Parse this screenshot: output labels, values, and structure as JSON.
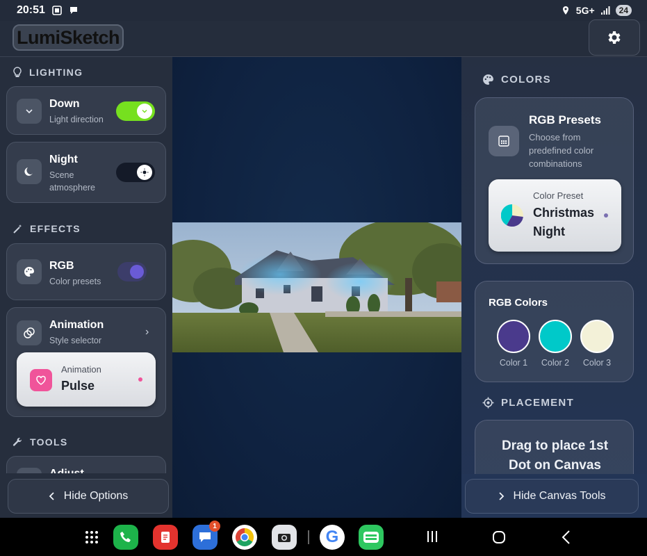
{
  "status_bar": {
    "time": "20:51",
    "network": "5G+",
    "battery": "24"
  },
  "app": {
    "logo_text": "LumiSketch"
  },
  "left_panel": {
    "lighting": {
      "heading": "LIGHTING",
      "direction": {
        "title": "Down",
        "subtitle": "Light direction",
        "toggle_on": true
      },
      "scene": {
        "title": "Night",
        "subtitle_line1": "Scene",
        "subtitle_line2": "atmosphere",
        "toggle_on": true
      }
    },
    "effects": {
      "heading": "EFFECTS",
      "rgb": {
        "title": "RGB",
        "subtitle": "Color presets",
        "toggle_on": true
      },
      "animation": {
        "title": "Animation",
        "subtitle": "Style selector",
        "selected_label": "Animation",
        "selected_value": "Pulse"
      }
    },
    "tools": {
      "heading": "TOOLS",
      "adjust_title": "Adjust"
    },
    "hide_button": "Hide Options"
  },
  "right_panel": {
    "colors_heading": "COLORS",
    "presets": {
      "title": "RGB Presets",
      "desc_line1": "Choose from",
      "desc_line2": "predefined color",
      "desc_line3": "combinations",
      "selected_label": "Color Preset",
      "selected_line1": "Christmas",
      "selected_line2": "Night"
    },
    "rgb_colors": {
      "title": "RGB Colors",
      "swatches": [
        {
          "label": "Color 1",
          "color": "#4a3a8c"
        },
        {
          "label": "Color 2",
          "color": "#00c9c9"
        },
        {
          "label": "Color 3",
          "color": "#f3f1d8"
        }
      ]
    },
    "placement": {
      "heading": "PLACEMENT",
      "line1": "Drag to place 1st",
      "line2": "Dot on Canvas"
    },
    "hide_button": "Hide Canvas Tools"
  },
  "dock": {
    "messages_badge": "1",
    "apps": [
      "app-drawer",
      "phone",
      "notes",
      "messages",
      "chrome",
      "camera",
      "google",
      "webtoon"
    ]
  },
  "colors": {
    "toggle_green": "#76e01f",
    "toggle_purple": "#6a5bd6",
    "accent_pink": "#f0549a"
  }
}
